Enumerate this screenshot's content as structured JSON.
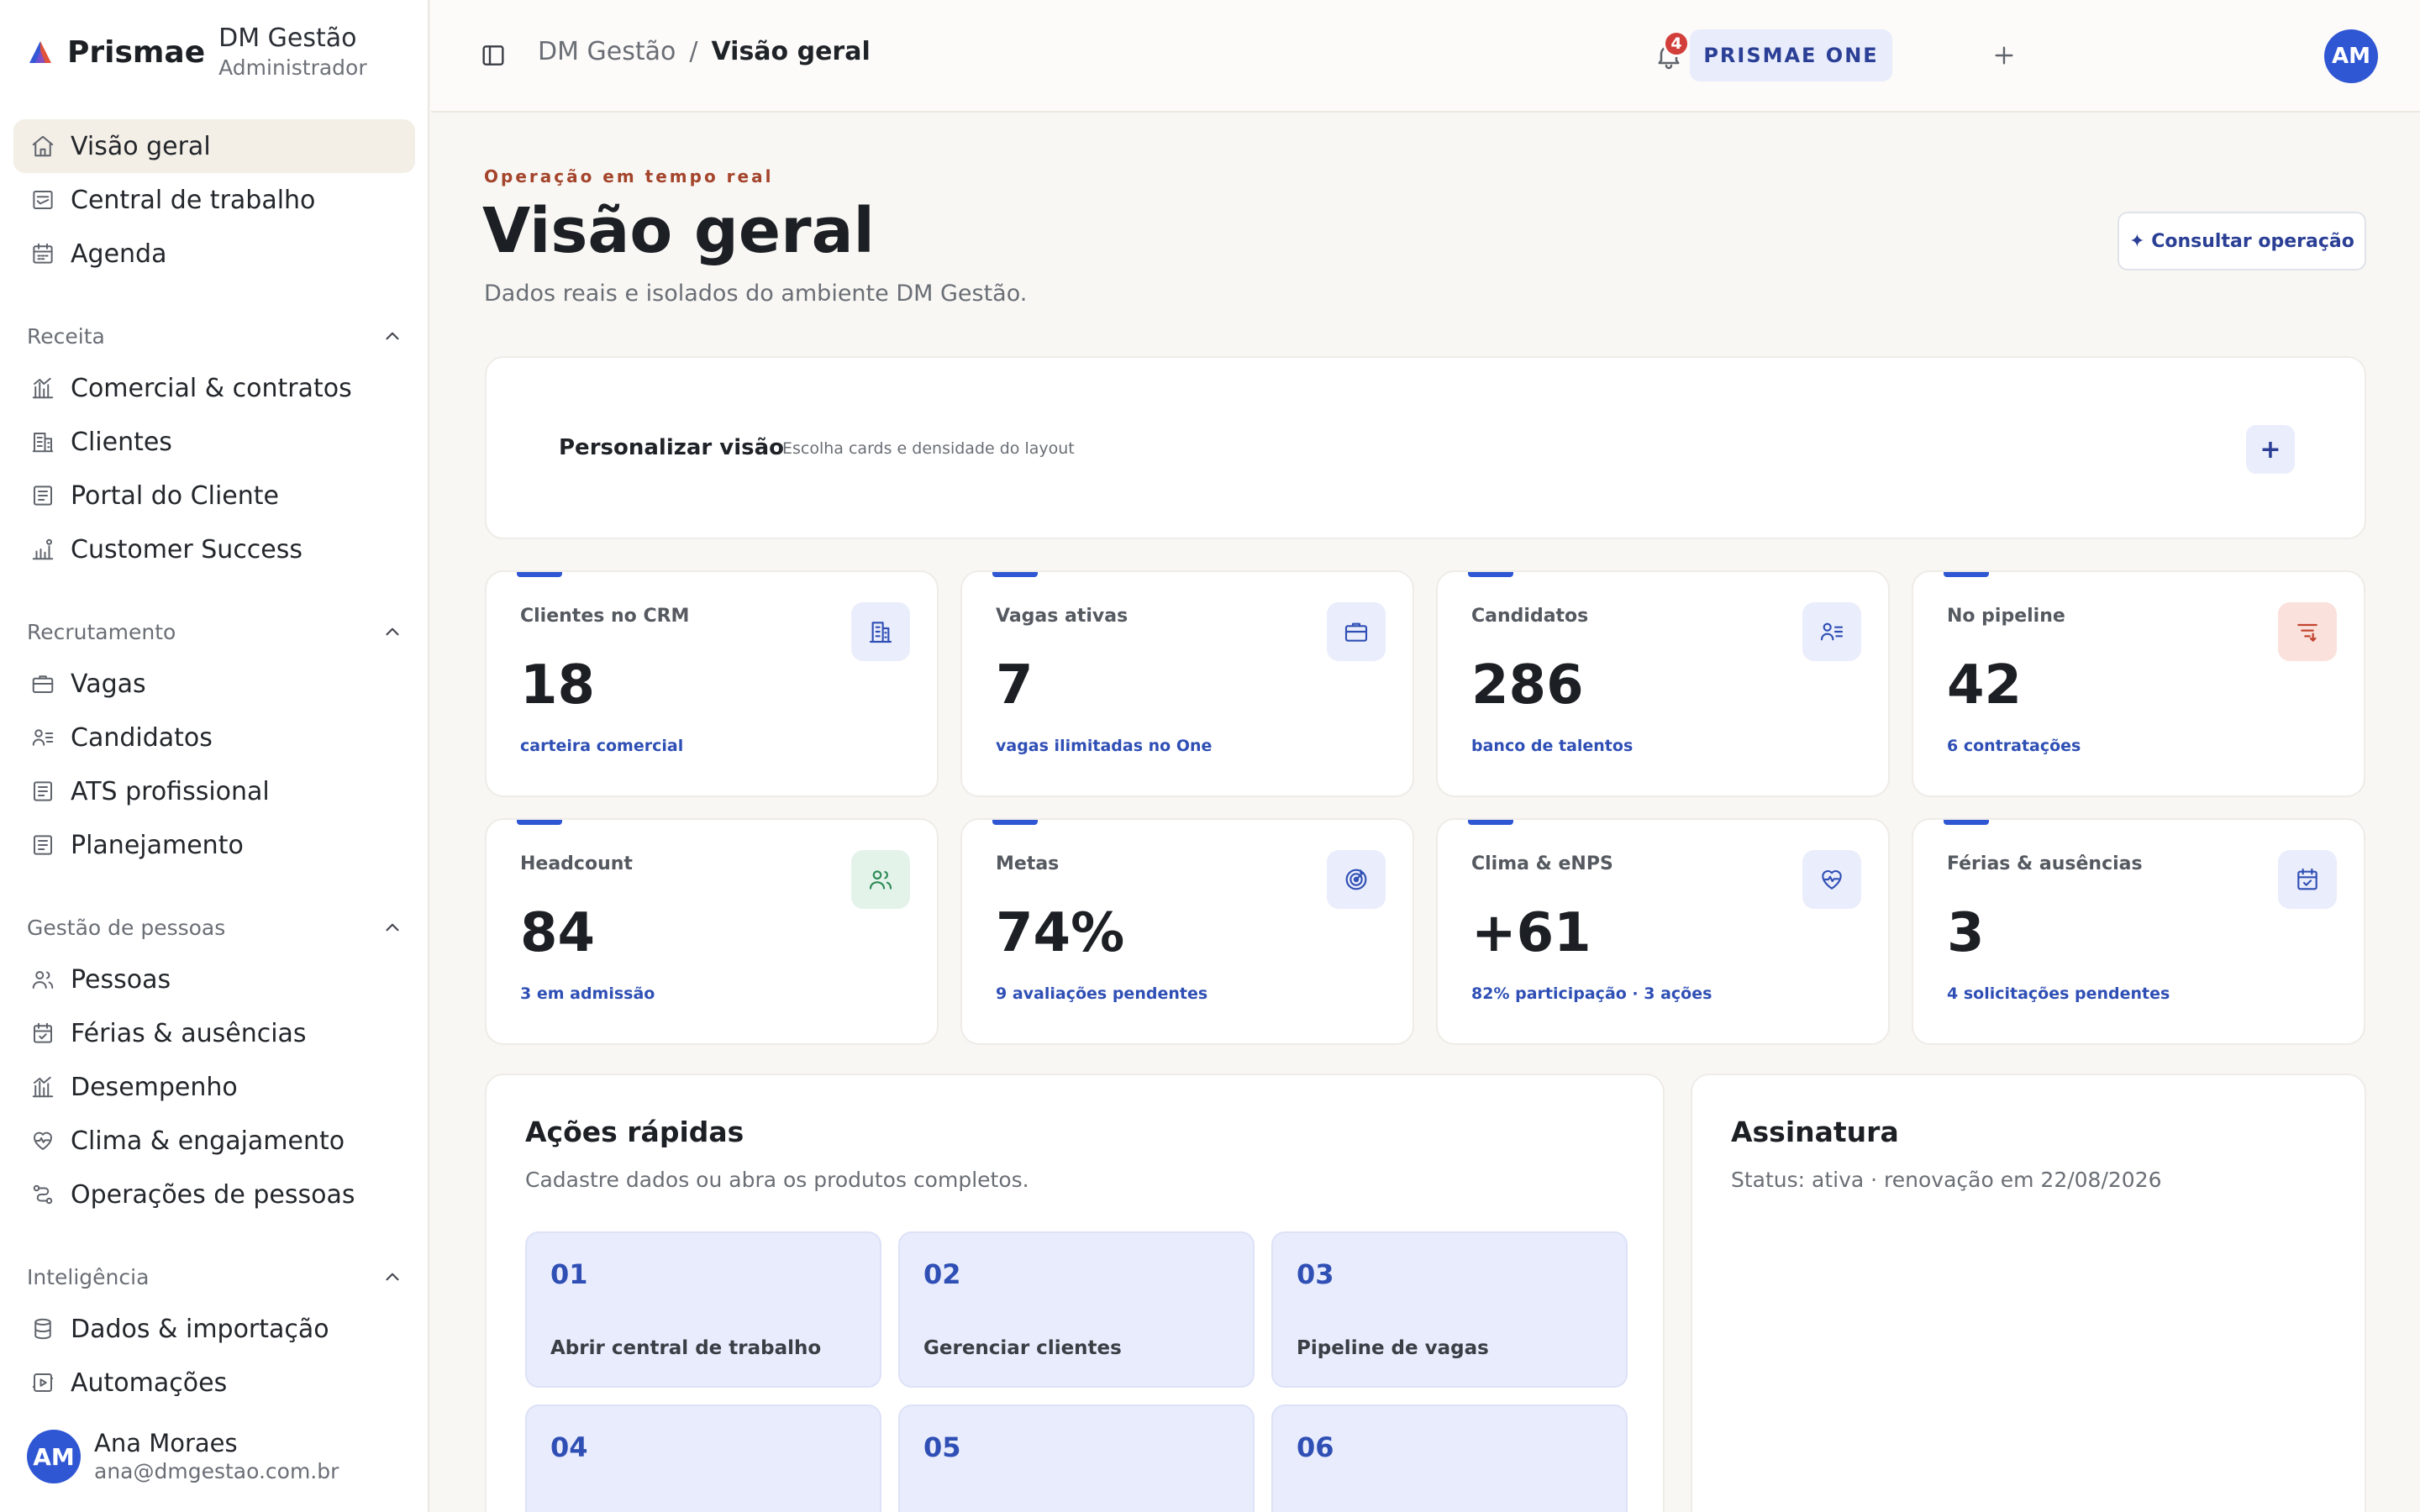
{
  "brand": {
    "name": "Prismae",
    "org_name": "DM Gestão",
    "org_role": "Administrador"
  },
  "sidebar": {
    "top_items": [
      {
        "label": "Visão geral",
        "icon": "home-icon",
        "active": true
      },
      {
        "label": "Central de trabalho",
        "icon": "inbox-icon"
      },
      {
        "label": "Agenda",
        "icon": "calendar-icon"
      }
    ],
    "sections": [
      {
        "label": "Receita",
        "items": [
          {
            "label": "Comercial & contratos",
            "icon": "chart-bars-icon"
          },
          {
            "label": "Clientes",
            "icon": "building-icon"
          },
          {
            "label": "Portal do Cliente",
            "icon": "document-icon"
          },
          {
            "label": "Customer Success",
            "icon": "growth-icon"
          }
        ]
      },
      {
        "label": "Recrutamento",
        "items": [
          {
            "label": "Vagas",
            "icon": "briefcase-icon"
          },
          {
            "label": "Candidatos",
            "icon": "user-list-icon"
          },
          {
            "label": "ATS profissional",
            "icon": "document-icon"
          },
          {
            "label": "Planejamento",
            "icon": "document-icon"
          }
        ]
      },
      {
        "label": "Gestão de pessoas",
        "items": [
          {
            "label": "Pessoas",
            "icon": "users-icon"
          },
          {
            "label": "Férias & ausências",
            "icon": "calendar-check-icon"
          },
          {
            "label": "Desempenho",
            "icon": "chart-bars-icon"
          },
          {
            "label": "Clima & engajamento",
            "icon": "heart-pulse-icon"
          },
          {
            "label": "Operações de pessoas",
            "icon": "workflow-icon"
          }
        ]
      },
      {
        "label": "Inteligência",
        "items": [
          {
            "label": "Dados & importação",
            "icon": "database-icon"
          },
          {
            "label": "Automações",
            "icon": "automation-icon"
          }
        ]
      }
    ],
    "user": {
      "initials": "AM",
      "name": "Ana Moraes",
      "email": "ana@dmgestao.com.br"
    }
  },
  "topbar": {
    "breadcrumb_parent": "DM Gestão",
    "breadcrumb_sep": "/",
    "breadcrumb_current": "Visão geral",
    "notifications_count": "4",
    "plan_label": "PRISMAE ONE",
    "avatar_initials": "AM"
  },
  "header": {
    "eyebrow": "Operação em tempo real",
    "title": "Visão geral",
    "subtitle": "Dados reais e isolados do ambiente DM Gestão.",
    "consult_label": "✦ Consultar operação"
  },
  "customize": {
    "title": "Personalizar visão",
    "subtitle": "Escolha cards e densidade do layout",
    "add_label": "+"
  },
  "stats": [
    {
      "label": "Clientes no CRM",
      "value": "18",
      "note": "carteira comercial",
      "icon": "building-icon",
      "tone": "blue"
    },
    {
      "label": "Vagas ativas",
      "value": "7",
      "note": "vagas ilimitadas no One",
      "icon": "briefcase-icon",
      "tone": "blue"
    },
    {
      "label": "Candidatos",
      "value": "286",
      "note": "banco de talentos",
      "icon": "user-list-icon",
      "tone": "blue"
    },
    {
      "label": "No pipeline",
      "value": "42",
      "note": "6 contratações",
      "icon": "filter-icon",
      "tone": "red"
    },
    {
      "label": "Headcount",
      "value": "84",
      "note": "3 em admissão",
      "icon": "users-icon",
      "tone": "green"
    },
    {
      "label": "Metas",
      "value": "74%",
      "note": "9 avaliações pendentes",
      "icon": "target-icon",
      "tone": "blue"
    },
    {
      "label": "Clima & eNPS",
      "value": "+61",
      "note": "82% participação · 3 ações",
      "icon": "heart-pulse-icon",
      "tone": "blue"
    },
    {
      "label": "Férias & ausências",
      "value": "3",
      "note": "4 solicitações pendentes",
      "icon": "calendar-check-icon",
      "tone": "blue"
    }
  ],
  "quick_actions": {
    "title": "Ações rápidas",
    "subtitle": "Cadastre dados ou abra os produtos completos.",
    "tiles": [
      {
        "num": "01",
        "label": "Abrir central de trabalho"
      },
      {
        "num": "02",
        "label": "Gerenciar clientes"
      },
      {
        "num": "03",
        "label": "Pipeline de vagas"
      },
      {
        "num": "04",
        "label": ""
      },
      {
        "num": "05",
        "label": ""
      },
      {
        "num": "06",
        "label": ""
      }
    ]
  },
  "subscription": {
    "title": "Assinatura",
    "status": "Status: ativa · renovação em 22/08/2026"
  },
  "colors": {
    "accent": "#2f56d3",
    "eyebrow": "#a4442b",
    "badge": "#d23f3b"
  }
}
